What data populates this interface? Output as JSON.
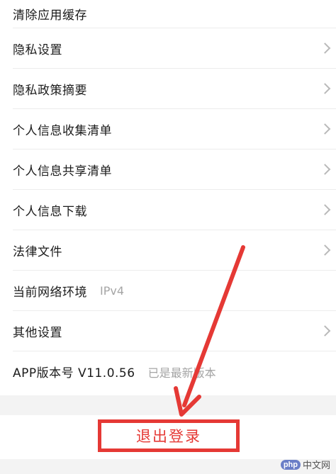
{
  "settings": {
    "items": [
      {
        "label": "清除应用缓存",
        "value": "",
        "chevron": false
      },
      {
        "label": "隐私设置",
        "value": "",
        "chevron": true
      },
      {
        "label": "隐私政策摘要",
        "value": "",
        "chevron": true
      },
      {
        "label": "个人信息收集清单",
        "value": "",
        "chevron": true
      },
      {
        "label": "个人信息共享清单",
        "value": "",
        "chevron": true
      },
      {
        "label": "个人信息下载",
        "value": "",
        "chevron": true
      },
      {
        "label": "法律文件",
        "value": "",
        "chevron": true
      },
      {
        "label": "当前网络环境",
        "value": "IPv4",
        "chevron": false
      },
      {
        "label": "其他设置",
        "value": "",
        "chevron": true
      },
      {
        "label": "APP版本号 V11.0.56",
        "value": "已是最新版本",
        "chevron": false
      }
    ]
  },
  "logout": {
    "label": "退出登录"
  },
  "annotation": {
    "arrow_color": "#e53935"
  },
  "watermark": {
    "logo": "php",
    "text": "中文网"
  }
}
